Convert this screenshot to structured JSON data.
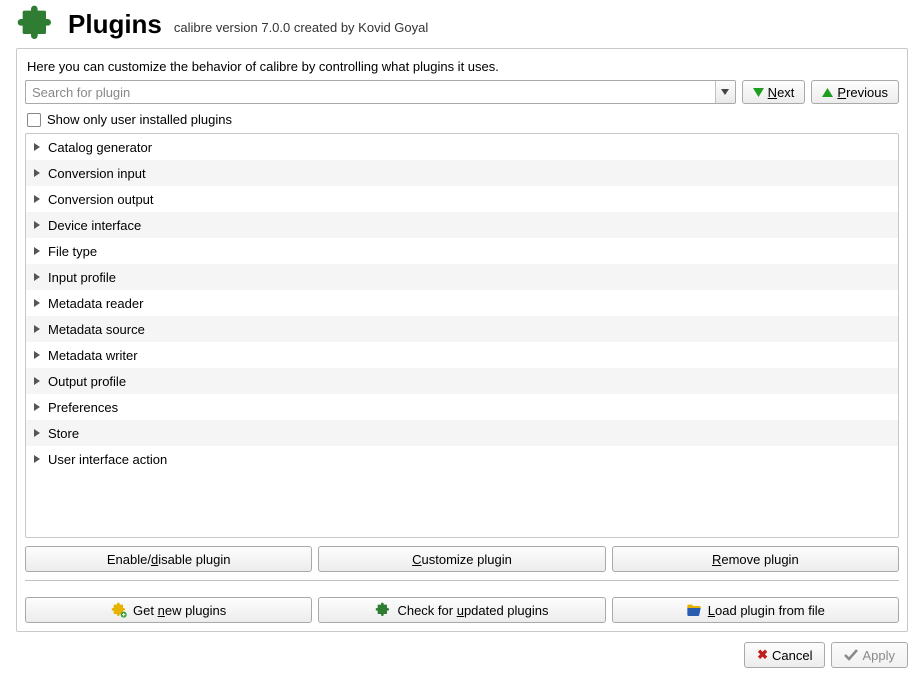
{
  "header": {
    "title": "Plugins",
    "subtitle": "calibre version 7.0.0 created by Kovid Goyal"
  },
  "intro": "Here you can customize the behavior of calibre by controlling what plugins it uses.",
  "search": {
    "placeholder": "Search for plugin",
    "value": "",
    "next_pre": "",
    "next_ul": "N",
    "next_post": "ext",
    "prev_pre": "",
    "prev_ul": "P",
    "prev_post": "revious"
  },
  "show_only": {
    "pre": "Show only ",
    "ul": "u",
    "post": "ser installed plugins",
    "checked": false
  },
  "categories": [
    "Catalog generator",
    "Conversion input",
    "Conversion output",
    "Device interface",
    "File type",
    "Input profile",
    "Metadata reader",
    "Metadata source",
    "Metadata writer",
    "Output profile",
    "Preferences",
    "Store",
    "User interface action"
  ],
  "actions": {
    "enable_disable": {
      "pre": "Enable/",
      "ul": "d",
      "post": "isable plugin"
    },
    "customize": {
      "pre": "",
      "ul": "C",
      "post": "ustomize plugin"
    },
    "remove": {
      "pre": "",
      "ul": "R",
      "post": "emove plugin"
    },
    "get_new": {
      "pre": "Get ",
      "ul": "n",
      "post": "ew plugins"
    },
    "check_updates": {
      "pre": "Check for ",
      "ul": "u",
      "post": "pdated plugins"
    },
    "load_file": {
      "pre": "",
      "ul": "L",
      "post": "oad plugin from file"
    }
  },
  "footer": {
    "cancel": "Cancel",
    "apply": "Apply"
  }
}
